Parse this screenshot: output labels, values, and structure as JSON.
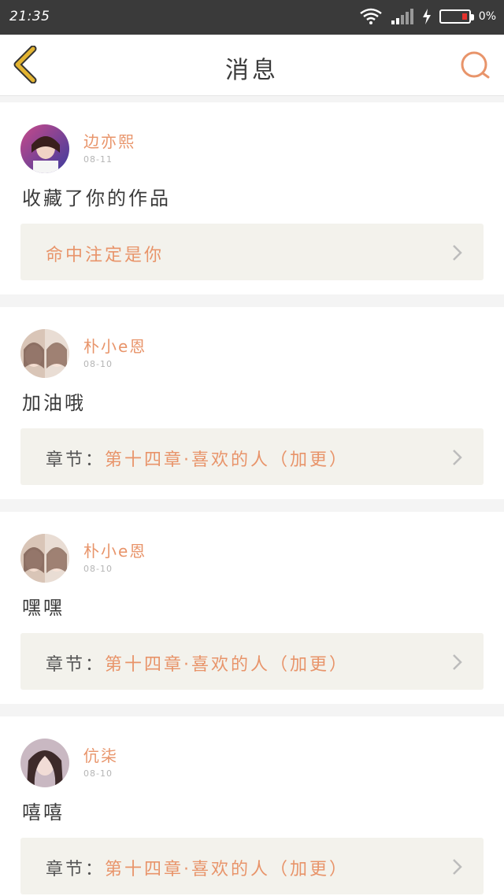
{
  "status": {
    "time": "21:35",
    "battery": "0%"
  },
  "header": {
    "title": "消息"
  },
  "messages": [
    {
      "user": "边亦熙",
      "date": "08-11",
      "text": "收藏了你的作品",
      "link_prefix": "",
      "link_title": "命中注定是你"
    },
    {
      "user": "朴小e恩",
      "date": "08-10",
      "text": "加油哦",
      "link_prefix": "章节：",
      "link_title": "第十四章·喜欢的人（加更）"
    },
    {
      "user": "朴小e恩",
      "date": "08-10",
      "text": "嘿嘿",
      "link_prefix": "章节：",
      "link_title": "第十四章·喜欢的人（加更）"
    },
    {
      "user": "伉柒",
      "date": "08-10",
      "text": "嘻嘻",
      "link_prefix": "章节：",
      "link_title": "第十四章·喜欢的人（加更）"
    }
  ],
  "colors": {
    "accent": "#e8946a",
    "link_bg": "#f3f2ec",
    "back_icon": "#e3b432"
  }
}
